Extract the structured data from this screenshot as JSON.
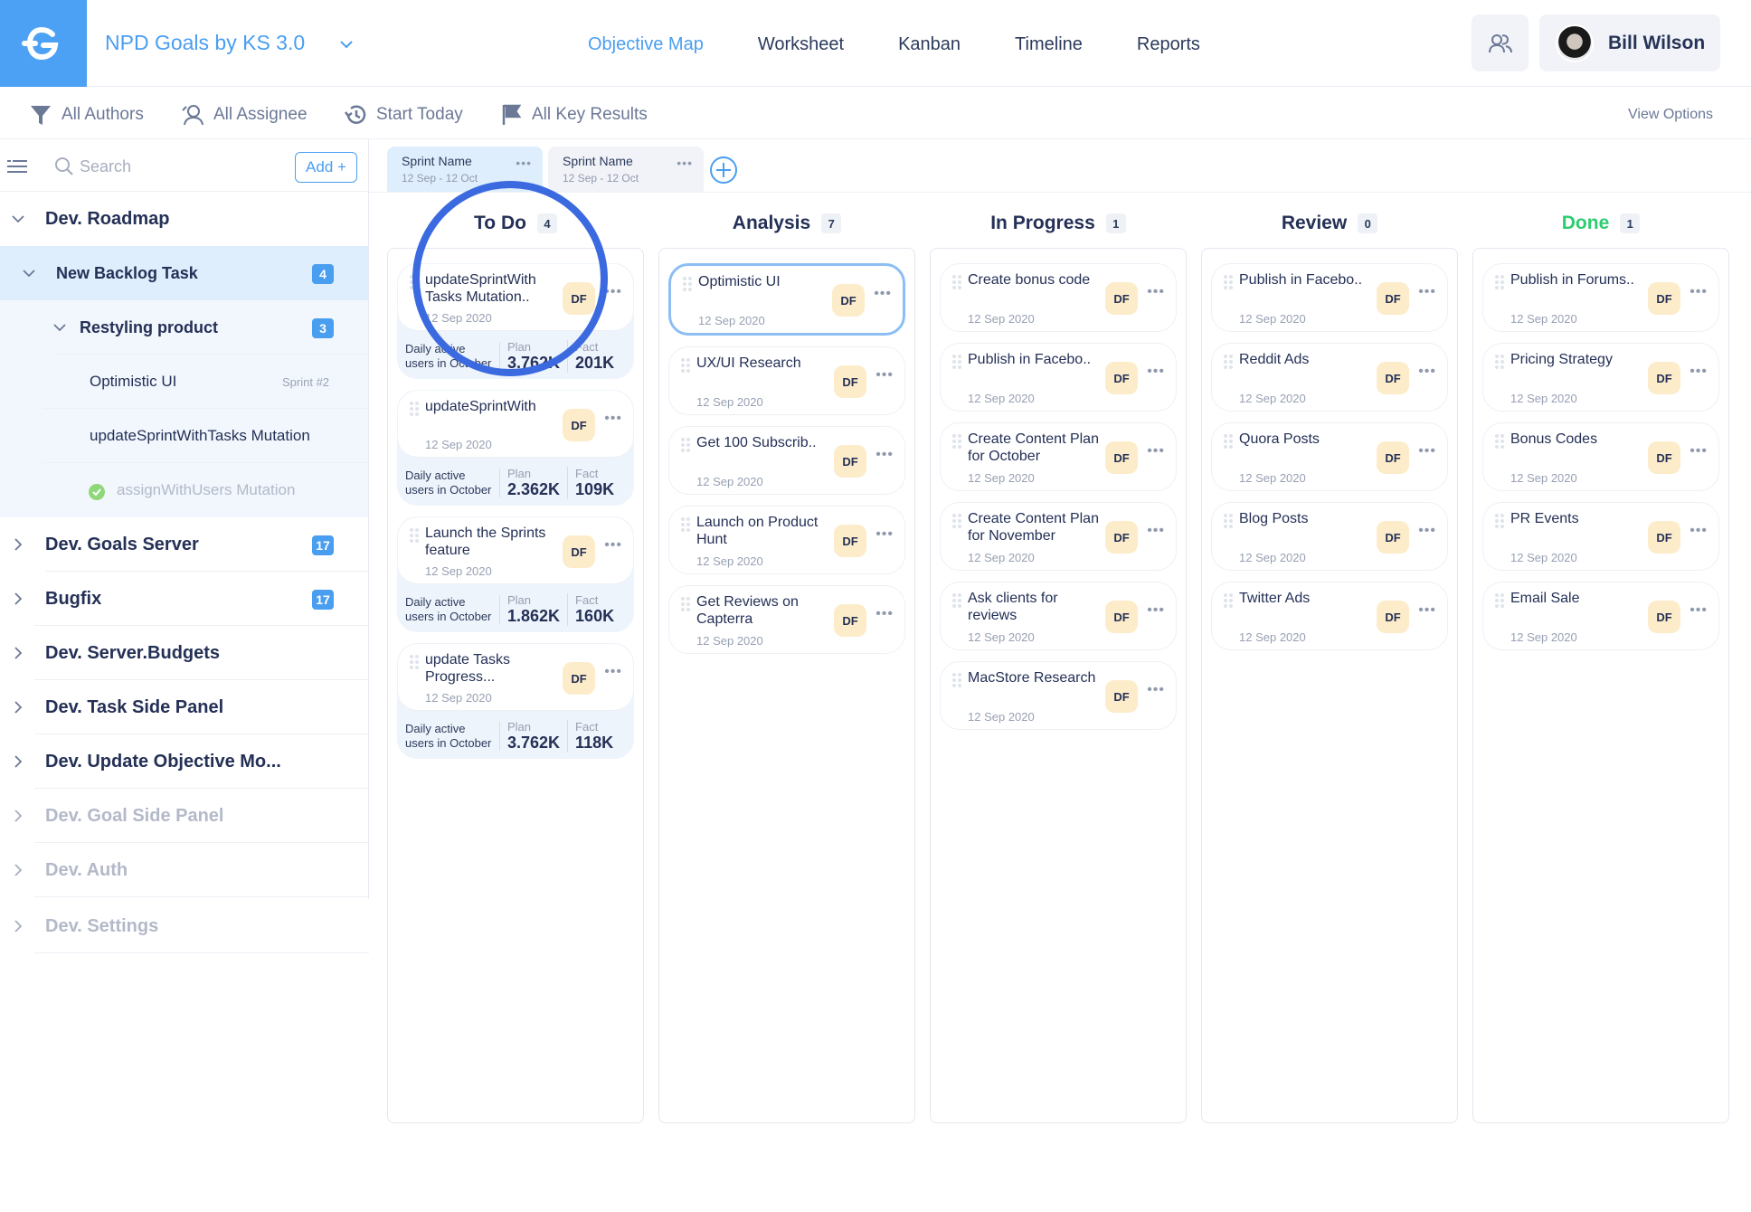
{
  "header": {
    "project_title": "NPD Goals by KS 3.0",
    "nav": [
      {
        "label": "Objective Map",
        "active": true
      },
      {
        "label": "Worksheet",
        "active": false
      },
      {
        "label": "Kanban",
        "active": false
      },
      {
        "label": "Timeline",
        "active": false
      },
      {
        "label": "Reports",
        "active": false
      }
    ],
    "user_name": "Bill Wilson"
  },
  "filters": {
    "authors": "All Authors",
    "assignee": "All Assignee",
    "start": "Start Today",
    "key_results": "All Key Results",
    "view_options": "View Options"
  },
  "sidebar": {
    "search_placeholder": "Search",
    "add_label": "Add +",
    "tree": [
      {
        "label": "Dev. Roadmap",
        "level": 0,
        "expanded": true
      },
      {
        "label": "New Backlog Task",
        "level": 1,
        "expanded": true,
        "badge": "4",
        "selected": true
      },
      {
        "label": "Restyling product",
        "level": 2,
        "expanded": true,
        "badge": "3"
      },
      {
        "label": "Optimistic UI",
        "level": 3,
        "tag": "Sprint #2"
      },
      {
        "label": "updateSprintWithTasks Mutation",
        "level": 3
      },
      {
        "label": "assignWithUsers Mutation",
        "level": 3,
        "done": true
      },
      {
        "label": "Dev. Goals Server",
        "level": 0,
        "badge": "17"
      },
      {
        "label": "Bugfix",
        "level": 0,
        "badge": "17"
      },
      {
        "label": "Dev. Server.Budgets",
        "level": 0
      },
      {
        "label": "Dev. Task Side Panel",
        "level": 0
      },
      {
        "label": "Dev. Update Objective Mo...",
        "level": 0
      },
      {
        "label": "Dev. Goal Side Panel",
        "level": 0,
        "muted": true
      },
      {
        "label": "Dev. Auth",
        "level": 0,
        "muted": true
      },
      {
        "label": "Dev. Settings",
        "level": 0,
        "muted": true
      }
    ]
  },
  "sprints": [
    {
      "name": "Sprint Name",
      "dates": "12 Sep - 12 Oct",
      "active": true
    },
    {
      "name": "Sprint Name",
      "dates": "12 Sep - 12 Oct",
      "active": false
    }
  ],
  "columns": [
    {
      "title": "To Do",
      "count": "4",
      "cards": [
        {
          "title": "updateSprintWith Tasks Mutation..",
          "date": "12 Sep 2020",
          "assignee": "DF",
          "kr": {
            "label": "Daily active users in October",
            "plan_label": "Plan",
            "plan": "3.762K",
            "fact_label": "Fact",
            "fact": "201K"
          }
        },
        {
          "title": "updateSprintWith",
          "date": "12 Sep 2020",
          "assignee": "DF",
          "kr": {
            "label": "Daily active users in October",
            "plan_label": "Plan",
            "plan": "2.362K",
            "fact_label": "Fact",
            "fact": "109K"
          }
        },
        {
          "title": "Launch the Sprints feature",
          "date": "12 Sep 2020",
          "assignee": "DF",
          "kr": {
            "label": "Daily active users in October",
            "plan_label": "Plan",
            "plan": "1.862K",
            "fact_label": "Fact",
            "fact": "160K"
          }
        },
        {
          "title": "update Tasks Progress...",
          "date": "12 Sep 2020",
          "assignee": "DF",
          "kr": {
            "label": "Daily active users in October",
            "plan_label": "Plan",
            "plan": "3.762K",
            "fact_label": "Fact",
            "fact": "118K"
          }
        }
      ]
    },
    {
      "title": "Analysis",
      "count": "7",
      "cards": [
        {
          "title": "Optimistic UI",
          "date": "12 Sep 2020",
          "assignee": "DF",
          "selected": true
        },
        {
          "title": "UX/UI Research",
          "date": "12 Sep 2020",
          "assignee": "DF"
        },
        {
          "title": "Get 100 Subscrib..",
          "date": "12 Sep 2020",
          "assignee": "DF"
        },
        {
          "title": "Launch on Product Hunt",
          "date": "12 Sep 2020",
          "assignee": "DF"
        },
        {
          "title": "Get Reviews on Capterra",
          "date": "12 Sep 2020",
          "assignee": "DF"
        }
      ]
    },
    {
      "title": "In Progress",
      "count": "1",
      "cards": [
        {
          "title": "Create bonus code",
          "date": "12 Sep 2020",
          "assignee": "DF"
        },
        {
          "title": "Publish in Facebo..",
          "date": "12 Sep 2020",
          "assignee": "DF"
        },
        {
          "title": "Create Content Plan for October",
          "date": "12 Sep 2020",
          "assignee": "DF"
        },
        {
          "title": "Create Content Plan for November",
          "date": "12 Sep 2020",
          "assignee": "DF"
        },
        {
          "title": "Ask clients for reviews",
          "date": "12 Sep 2020",
          "assignee": "DF"
        },
        {
          "title": "MacStore Research",
          "date": "12 Sep 2020",
          "assignee": "DF"
        }
      ]
    },
    {
      "title": "Review",
      "count": "0",
      "cards": [
        {
          "title": "Publish in Facebo..",
          "date": "12 Sep 2020",
          "assignee": "DF"
        },
        {
          "title": "Reddit Ads",
          "date": "12 Sep 2020",
          "assignee": "DF"
        },
        {
          "title": "Quora Posts",
          "date": "12 Sep 2020",
          "assignee": "DF"
        },
        {
          "title": "Blog Posts",
          "date": "12 Sep 2020",
          "assignee": "DF"
        },
        {
          "title": "Twitter Ads",
          "date": "12 Sep 2020",
          "assignee": "DF"
        }
      ]
    },
    {
      "title": "Done",
      "count": "1",
      "accent": "#2ecc71",
      "cards": [
        {
          "title": "Publish in Forums..",
          "date": "12 Sep 2020",
          "assignee": "DF"
        },
        {
          "title": "Pricing Strategy",
          "date": "12 Sep 2020",
          "assignee": "DF"
        },
        {
          "title": "Bonus Codes",
          "date": "12 Sep 2020",
          "assignee": "DF"
        },
        {
          "title": "PR Events",
          "date": "12 Sep 2020",
          "assignee": "DF"
        },
        {
          "title": "Email Sale",
          "date": "12 Sep 2020",
          "assignee": "DF"
        }
      ]
    }
  ],
  "colors": {
    "brand": "#4da1f5",
    "accent": "#4a9ef0",
    "text": "#243056",
    "done": "#2ecc71",
    "assignee_bg": "#fdecc9",
    "highlight_ring": "#3b6ae0"
  }
}
